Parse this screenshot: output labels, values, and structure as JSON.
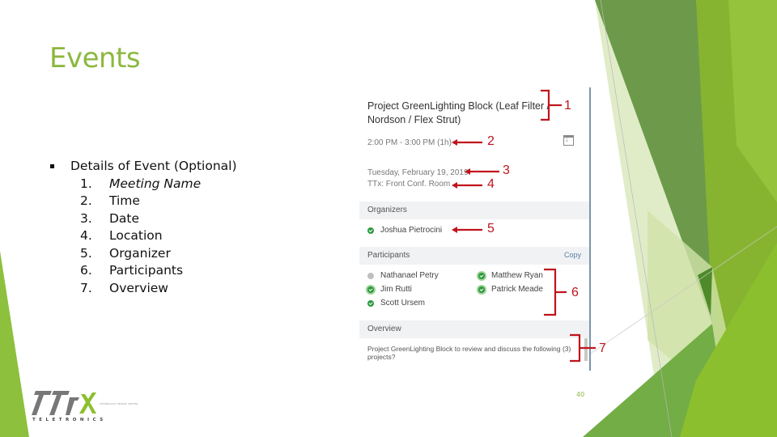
{
  "slide": {
    "title": "Events",
    "page_number": "40",
    "accent_color": "#8cb840",
    "bullet": {
      "label": "Details of Event (Optional)",
      "items": [
        {
          "num": "1.",
          "label": "Meeting Name"
        },
        {
          "num": "2.",
          "label": "Time"
        },
        {
          "num": "3.",
          "label": "Date"
        },
        {
          "num": "4.",
          "label": "Location"
        },
        {
          "num": "5.",
          "label": "Organizer"
        },
        {
          "num": "6.",
          "label": "Participants"
        },
        {
          "num": "7.",
          "label": "Overview"
        }
      ]
    }
  },
  "event_panel": {
    "meeting_name": "Project GreenLighting Block (Leaf Filter / Nordson / Flex Strut)",
    "time": "2:00 PM - 3:00 PM (1h)",
    "calendar_icon": "calendar-download-icon",
    "date": "Tuesday, February 19, 2019",
    "location": "TTx: Front Conf. Room",
    "organizers_header": "Organizers",
    "organizers": [
      {
        "name": "Joshua Pietrocini",
        "status": "accepted"
      }
    ],
    "participants_header": "Participants",
    "copy_label": "Copy",
    "participants": [
      {
        "name": "Nathanael Petry",
        "status": "unknown"
      },
      {
        "name": "Jim Rutti",
        "status": "accepted"
      },
      {
        "name": "Scott Ursem",
        "status": "accepted"
      },
      {
        "name": "Matthew Ryan",
        "status": "accepted"
      },
      {
        "name": "Patrick Meade",
        "status": "accepted"
      }
    ],
    "overview_header": "Overview",
    "overview_text": "Project GreenLighting Block to review and discuss the following (3) projects?"
  },
  "annotations": {
    "color": "#c0141c",
    "labels": [
      "1",
      "2",
      "3",
      "4",
      "5",
      "6",
      "7"
    ]
  },
  "logo": {
    "mark": "TTX",
    "wordmark": "TELETRONICS",
    "tagline": "TECHNOLOGY. PEOPLE. MATTER."
  }
}
